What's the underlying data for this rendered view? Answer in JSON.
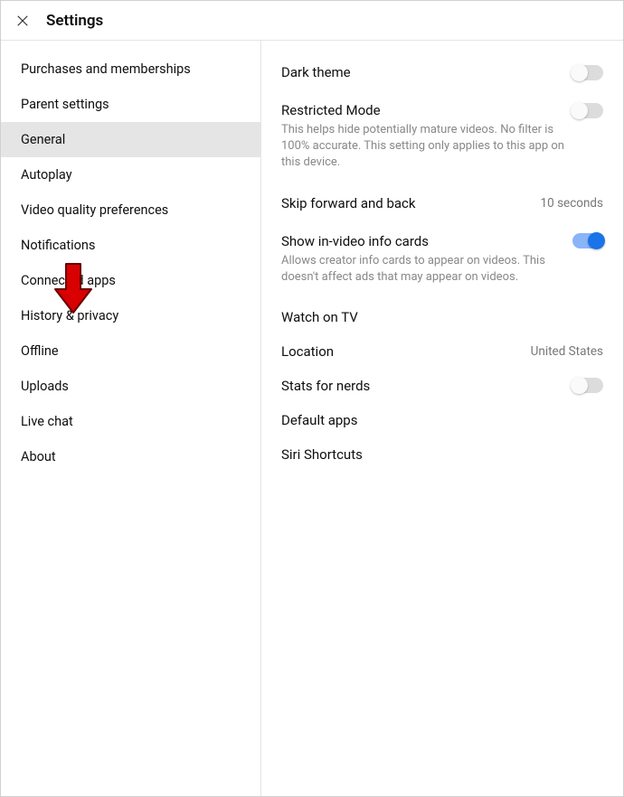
{
  "header": {
    "title": "Settings"
  },
  "sidebar": {
    "items": [
      {
        "label": "Purchases and memberships",
        "selected": false
      },
      {
        "label": "Parent settings",
        "selected": false
      },
      {
        "label": "General",
        "selected": true
      },
      {
        "label": "Autoplay",
        "selected": false
      },
      {
        "label": "Video quality preferences",
        "selected": false
      },
      {
        "label": "Notifications",
        "selected": false
      },
      {
        "label": "Connected apps",
        "selected": false
      },
      {
        "label": "History & privacy",
        "selected": false
      },
      {
        "label": "Offline",
        "selected": false
      },
      {
        "label": "Uploads",
        "selected": false
      },
      {
        "label": "Live chat",
        "selected": false
      },
      {
        "label": "About",
        "selected": false
      }
    ]
  },
  "main": {
    "dark_theme": {
      "label": "Dark theme",
      "on": false
    },
    "restricted_mode": {
      "label": "Restricted Mode",
      "on": false,
      "desc": "This helps hide potentially mature videos. No filter is 100% accurate. This setting only applies to this app on this device."
    },
    "skip": {
      "label": "Skip forward and back",
      "value": "10 seconds"
    },
    "info_cards": {
      "label": "Show in-video info cards",
      "on": true,
      "desc": "Allows creator info cards to appear on videos. This doesn't affect ads that may appear on videos."
    },
    "watch_tv": {
      "label": "Watch on TV"
    },
    "location": {
      "label": "Location",
      "value": "United States"
    },
    "stats_nerds": {
      "label": "Stats for nerds",
      "on": false
    },
    "default_apps": {
      "label": "Default apps"
    },
    "siri": {
      "label": "Siri Shortcuts"
    }
  }
}
